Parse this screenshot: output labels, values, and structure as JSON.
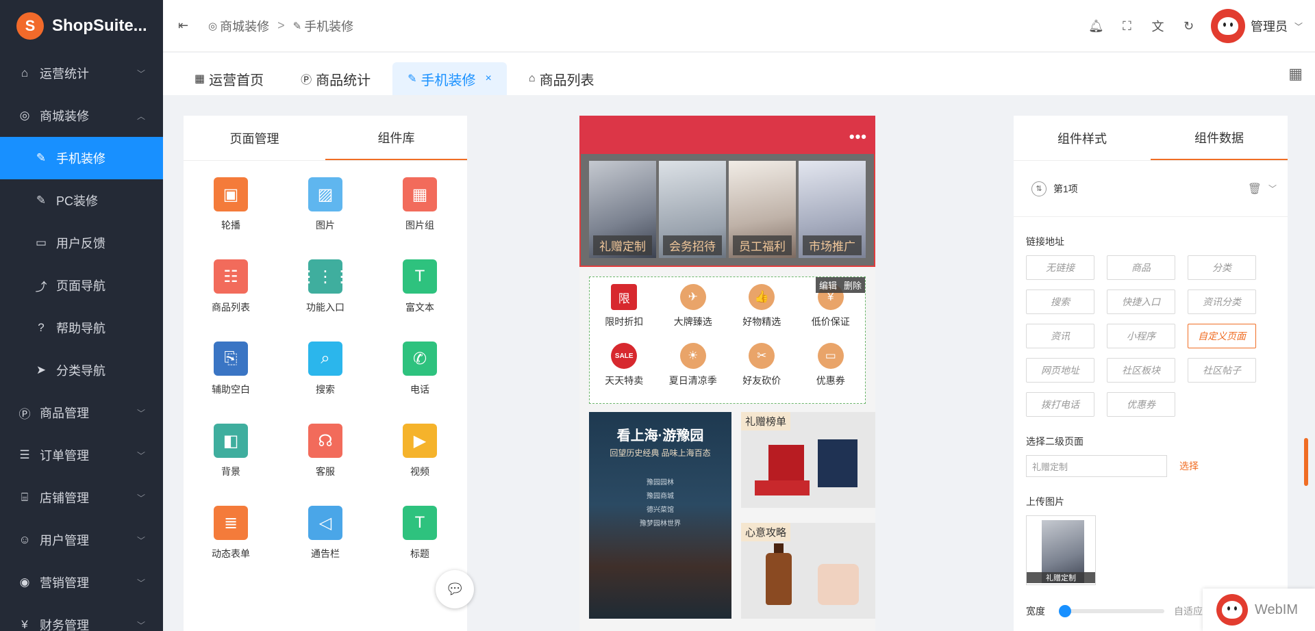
{
  "brand": {
    "name": "ShopSuite...",
    "logo_letter": "S"
  },
  "sidebar": {
    "items": [
      {
        "icon": "home-icon",
        "glyph": "⌂",
        "label": "运营统计",
        "arrow": "﹀",
        "sub": false,
        "active": false
      },
      {
        "icon": "decor-icon",
        "glyph": "◎",
        "label": "商城装修",
        "arrow": "︿",
        "sub": false,
        "active": false
      },
      {
        "icon": "brush-icon",
        "glyph": "✎",
        "label": "手机装修",
        "arrow": "",
        "sub": true,
        "active": true
      },
      {
        "icon": "brush-icon",
        "glyph": "✎",
        "label": "PC装修",
        "arrow": "",
        "sub": true,
        "active": false
      },
      {
        "icon": "feedback-icon",
        "glyph": "▭",
        "label": "用户反馈",
        "arrow": "",
        "sub": true,
        "active": false
      },
      {
        "icon": "route-icon",
        "glyph": "⤴",
        "label": "页面导航",
        "arrow": "",
        "sub": true,
        "active": false
      },
      {
        "icon": "help-icon",
        "glyph": "?",
        "label": "帮助导航",
        "arrow": "",
        "sub": true,
        "active": false
      },
      {
        "icon": "cursor-icon",
        "glyph": "➤",
        "label": "分类导航",
        "arrow": "",
        "sub": true,
        "active": false
      },
      {
        "icon": "goods-icon",
        "glyph": "Ⓟ",
        "label": "商品管理",
        "arrow": "﹀",
        "sub": false,
        "active": false
      },
      {
        "icon": "list-icon",
        "glyph": "☰",
        "label": "订单管理",
        "arrow": "﹀",
        "sub": false,
        "active": false
      },
      {
        "icon": "store-icon",
        "glyph": "⌸",
        "label": "店铺管理",
        "arrow": "﹀",
        "sub": false,
        "active": false
      },
      {
        "icon": "user-icon",
        "glyph": "☺",
        "label": "用户管理",
        "arrow": "﹀",
        "sub": false,
        "active": false
      },
      {
        "icon": "broadcast-icon",
        "glyph": "◉",
        "label": "营销管理",
        "arrow": "﹀",
        "sub": false,
        "active": false
      },
      {
        "icon": "finance-icon",
        "glyph": "¥",
        "label": "财务管理",
        "arrow": "﹀",
        "sub": false,
        "active": false
      }
    ]
  },
  "topbar": {
    "breadcrumbs": [
      "商城装修",
      "手机装修"
    ],
    "separator": ">",
    "admin_name": "管理员"
  },
  "tabs": [
    {
      "icon": "grid-icon",
      "glyph": "▦",
      "label": "运营首页",
      "active": false
    },
    {
      "icon": "goods-stat-icon",
      "glyph": "Ⓟ",
      "label": "商品统计",
      "active": false
    },
    {
      "icon": "brush-icon",
      "glyph": "✎",
      "label": "手机装修",
      "active": true
    },
    {
      "icon": "basket-icon",
      "glyph": "⌂",
      "label": "商品列表",
      "active": false
    }
  ],
  "left_panel": {
    "tabs": [
      "页面管理",
      "组件库"
    ],
    "active_tab": 1,
    "components": [
      {
        "label": "轮播",
        "icon": "carousel-icon",
        "glyph": "▣",
        "color": "#f47b3a"
      },
      {
        "label": "图片",
        "icon": "image-icon",
        "glyph": "▨",
        "color": "#5fb6ef"
      },
      {
        "label": "图片组",
        "icon": "image-group-icon",
        "glyph": "▦",
        "color": "#f26b5b"
      },
      {
        "label": "商品列表",
        "icon": "goods-list-icon",
        "glyph": "☷",
        "color": "#f26b5b"
      },
      {
        "label": "功能入口",
        "icon": "entry-icon",
        "glyph": "⋮⋮⋮",
        "color": "#3fae9e"
      },
      {
        "label": "富文本",
        "icon": "richtext-icon",
        "glyph": "T",
        "color": "#2ec27e"
      },
      {
        "label": "辅助空白",
        "icon": "blank-icon",
        "glyph": "⎘",
        "color": "#3a75c4"
      },
      {
        "label": "搜索",
        "icon": "search-icon",
        "glyph": "⌕",
        "color": "#2bb6ec"
      },
      {
        "label": "电话",
        "icon": "phone-icon",
        "glyph": "✆",
        "color": "#2ec27e"
      },
      {
        "label": "背景",
        "icon": "background-icon",
        "glyph": "◧",
        "color": "#3fae9e"
      },
      {
        "label": "客服",
        "icon": "service-icon",
        "glyph": "☊",
        "color": "#f26b5b"
      },
      {
        "label": "视频",
        "icon": "video-icon",
        "glyph": "▶",
        "color": "#f5b32b"
      },
      {
        "label": "动态表单",
        "icon": "form-icon",
        "glyph": "≣",
        "color": "#f47b3a"
      },
      {
        "label": "通告栏",
        "icon": "notice-icon",
        "glyph": "◁",
        "color": "#4aa6e8"
      },
      {
        "label": "标题",
        "icon": "title-icon",
        "glyph": "T",
        "color": "#2ec27e"
      }
    ]
  },
  "phone": {
    "banner": [
      "礼赠定制",
      "会务招待",
      "员工福利",
      "市场推广"
    ],
    "edit_actions": [
      "编辑",
      "删除"
    ],
    "icons": [
      {
        "label": "限时折扣",
        "icon": "flash-sale-icon",
        "glyph": "限",
        "color": "#d7282e"
      },
      {
        "label": "大牌臻选",
        "icon": "plane-icon",
        "glyph": "✈",
        "color": "#e9a469"
      },
      {
        "label": "好物精选",
        "icon": "thumb-icon",
        "glyph": "👍",
        "color": "#e9a469"
      },
      {
        "label": "低价保证",
        "icon": "shield-icon",
        "glyph": "¥",
        "color": "#e9a469"
      },
      {
        "label": "天天特卖",
        "icon": "sale-icon",
        "glyph": "SALE",
        "color": "#d7282e"
      },
      {
        "label": "夏日清凉季",
        "icon": "sun-icon",
        "glyph": "☀",
        "color": "#e9a469"
      },
      {
        "label": "好友砍价",
        "icon": "tag-icon",
        "glyph": "✂",
        "color": "#e9a469"
      },
      {
        "label": "优惠券",
        "icon": "coupon-icon",
        "glyph": "▭",
        "color": "#e9a469"
      }
    ],
    "promo": {
      "title": "看上海·游豫园",
      "subtitle": "回望历史经典 品味上海百态",
      "lines": [
        "豫园园林",
        "豫园商城",
        "德兴菜馆",
        "豫梦园林世界"
      ],
      "tags": [
        "礼赠榜单",
        "心意攻略"
      ]
    }
  },
  "right_panel": {
    "tabs": [
      "组件样式",
      "组件数据"
    ],
    "active_tab": 1,
    "item_title": "第1项",
    "link_label": "链接地址",
    "links": [
      "无链接",
      "商品",
      "分类",
      "搜索",
      "快捷入口",
      "资讯分类",
      "资讯",
      "小程序",
      "自定义页面",
      "网页地址",
      "社区板块",
      "社区帖子",
      "拨打电话",
      "优惠券"
    ],
    "active_link": 8,
    "second_page_label": "选择二级页面",
    "second_page_value": "礼赠定制",
    "select_link": "选择",
    "upload_label": "上传图片",
    "upload_caption": "礼赠定制",
    "width_label": "宽度",
    "auto_label": "自适应"
  },
  "webim": {
    "label": "WebIM"
  }
}
